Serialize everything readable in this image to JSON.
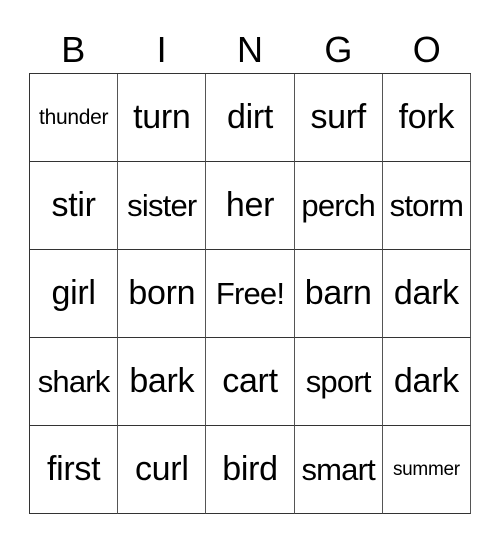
{
  "header": [
    "B",
    "I",
    "N",
    "G",
    "O"
  ],
  "cells": [
    [
      "thunder",
      "turn",
      "dirt",
      "surf",
      "fork"
    ],
    [
      "stir",
      "sister",
      "her",
      "perch",
      "storm"
    ],
    [
      "girl",
      "born",
      "Free!",
      "barn",
      "dark"
    ],
    [
      "shark",
      "bark",
      "cart",
      "sport",
      "dark"
    ],
    [
      "first",
      "curl",
      "bird",
      "smart",
      "summer"
    ]
  ]
}
